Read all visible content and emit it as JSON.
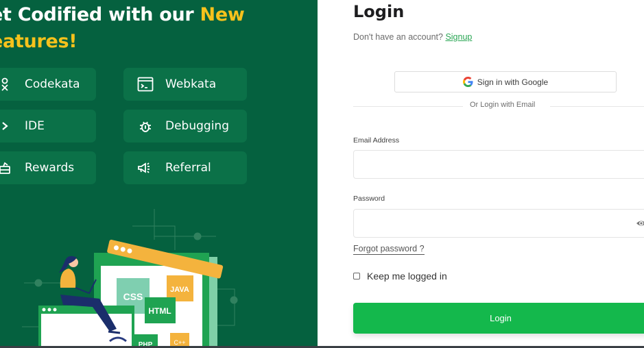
{
  "left_panel": {
    "headline_white": "et Codified with our ",
    "headline_yellow_1": "New",
    "headline_yellow_2": "eatures!",
    "features": [
      {
        "label": "Codekata",
        "icon": "code-shapes-icon"
      },
      {
        "label": "Webkata",
        "icon": "terminal-window-icon"
      },
      {
        "label": "IDE",
        "icon": "chevron-right-icon"
      },
      {
        "label": "Debugging",
        "icon": "bug-icon"
      },
      {
        "label": "Rewards",
        "icon": "gift-icon"
      },
      {
        "label": "Referral",
        "icon": "megaphone-icon"
      }
    ],
    "illustration": {
      "tags": [
        "CSS",
        "JAVA",
        "HTML",
        "PHP",
        "C++"
      ]
    }
  },
  "login": {
    "title": "Login",
    "no_account_text": "Don't have an account?",
    "signup_link": "Signup",
    "google_button": "Sign in with Google",
    "or_text": "Or Login with Email",
    "email_label": "Email Address",
    "email_value": "",
    "password_label": "Password",
    "password_value": "",
    "forgot_link": "Forgot password ?",
    "keep_logged_in": "Keep me logged in",
    "keep_logged_in_checked": false,
    "login_button": "Login"
  },
  "colors": {
    "left_bg": "#05613f",
    "accent_yellow": "#f6c21c",
    "login_green": "#14b84c",
    "link_green": "#2aa654"
  }
}
